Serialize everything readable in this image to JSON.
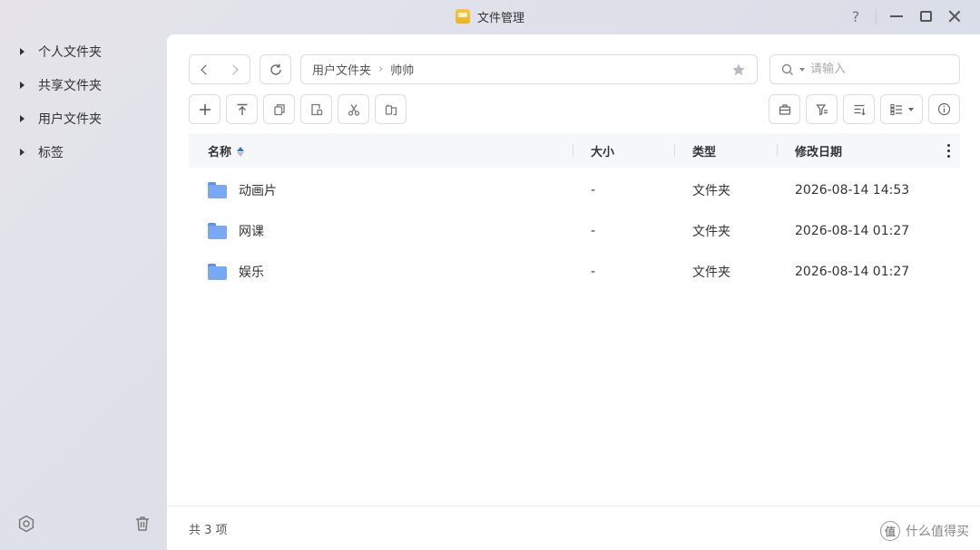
{
  "window": {
    "title": "文件管理",
    "help_label": "?"
  },
  "sidebar": {
    "items": [
      {
        "label": "个人文件夹"
      },
      {
        "label": "共享文件夹"
      },
      {
        "label": "用户文件夹"
      },
      {
        "label": "标签"
      }
    ]
  },
  "path": {
    "segments": [
      "用户文件夹",
      "帅帅"
    ],
    "separator": "›"
  },
  "search": {
    "placeholder": "请输入"
  },
  "table": {
    "columns": [
      "名称",
      "大小",
      "类型",
      "修改日期"
    ],
    "rows": [
      {
        "name": "动画片",
        "size": "-",
        "type": "文件夹",
        "modified": "2026-08-14 14:53"
      },
      {
        "name": "网课",
        "size": "-",
        "type": "文件夹",
        "modified": "2026-08-14 01:27"
      },
      {
        "name": "娱乐",
        "size": "-",
        "type": "文件夹",
        "modified": "2026-08-14 01:27"
      }
    ]
  },
  "footer": {
    "count_text": "共 3 项"
  },
  "watermark": {
    "text": "什么值得买",
    "logo_char": "值"
  },
  "colors": {
    "accent": "#2f6fe4",
    "folder": "#79a8f5",
    "app_icon": "#f6c743"
  }
}
